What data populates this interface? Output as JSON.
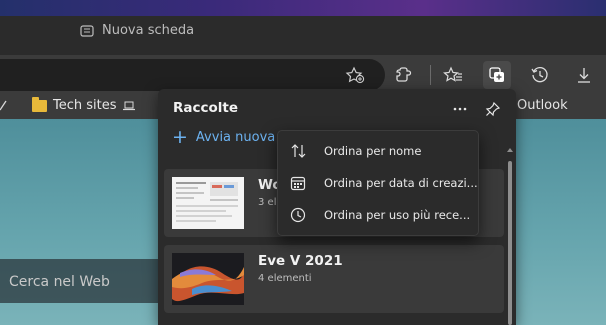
{
  "tab": {
    "title": "Nuova scheda",
    "icon": "new-tab-icon"
  },
  "toolbar": {
    "buttons": [
      {
        "name": "favorite-star-add-icon"
      },
      {
        "name": "extensions-icon"
      },
      {
        "name": "favorites-icon"
      },
      {
        "name": "collections-icon",
        "active": true
      },
      {
        "name": "history-icon"
      },
      {
        "name": "downloads-icon"
      }
    ]
  },
  "favorites_bar": {
    "items": [
      {
        "label": "Tech sites",
        "icon": "folder-icon"
      },
      {
        "label": "Outlook",
        "icon": "folder-icon"
      }
    ]
  },
  "search": {
    "placeholder": "Cerca nel Web"
  },
  "collections_panel": {
    "title": "Raccolte",
    "start_new_label": "Avvia nuova ra",
    "cards": [
      {
        "title": "Wo",
        "subtitle": "3 ele"
      },
      {
        "title": "Eve V 2021",
        "subtitle": "4 elementi"
      }
    ]
  },
  "sort_menu": {
    "items": [
      {
        "label": "Ordina per nome",
        "icon": "sort-arrows-icon"
      },
      {
        "label": "Ordina per data di creazi...",
        "icon": "calendar-icon"
      },
      {
        "label": "Ordina per uso più rece...",
        "icon": "clock-icon"
      }
    ]
  },
  "colors": {
    "accent": "#6cb2f0",
    "panel_bg": "#2b2b2b",
    "toolbar_bg": "#3b3b3b",
    "folder": "#e8b93a"
  }
}
